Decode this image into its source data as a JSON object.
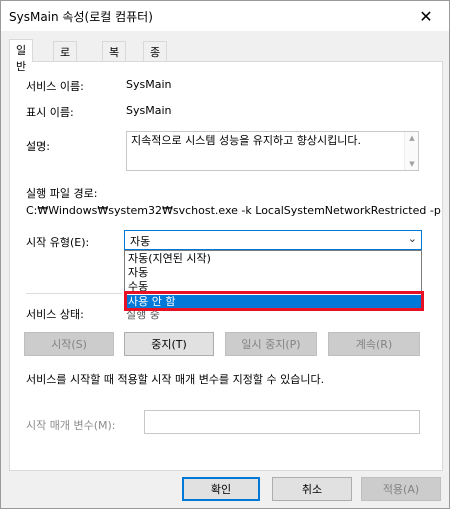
{
  "window": {
    "title": "SysMain 속성(로컬 컴퓨터)",
    "close_glyph": "✕"
  },
  "tabs": [
    {
      "label": "일반",
      "active": true
    },
    {
      "label": "로그온",
      "active": false
    },
    {
      "label": "복구",
      "active": false
    },
    {
      "label": "종속성",
      "active": false
    }
  ],
  "general": {
    "service_name_label": "서비스 이름:",
    "service_name_value": "SysMain",
    "display_name_label": "표시 이름:",
    "display_name_value": "SysMain",
    "description_label": "설명:",
    "description_value": "지속적으로 시스템 성능을 유지하고 향상시킵니다.",
    "exe_path_label": "실행 파일 경로:",
    "exe_path_value": "C:₩Windows₩system32₩svchost.exe -k LocalSystemNetworkRestricted -p",
    "startup_type_label": "시작 유형(E):",
    "startup_type_value": "자동",
    "startup_options": [
      {
        "label": "자동(지연된 시작)",
        "selected": false
      },
      {
        "label": "자동",
        "selected": false
      },
      {
        "label": "수동",
        "selected": false
      },
      {
        "label": "사용 안 함",
        "selected": true
      }
    ],
    "status_label": "서비스 상태:",
    "status_value": "실행 중",
    "buttons": {
      "start": "시작(S)",
      "stop": "중지(T)",
      "pause": "일시 중지(P)",
      "resume": "계속(R)"
    },
    "hint": "서비스를 시작할 때 적용할 시작 매개 변수를 지정할 수 있습니다.",
    "params_label": "시작 매개 변수(M):",
    "params_value": ""
  },
  "footer": {
    "ok": "확인",
    "cancel": "취소",
    "apply": "적용(A)"
  },
  "colors": {
    "accent": "#0078d7",
    "highlight_border": "#e81123"
  },
  "icons": {
    "close": "close-icon",
    "combo_arrow": "chevron-down-icon"
  }
}
